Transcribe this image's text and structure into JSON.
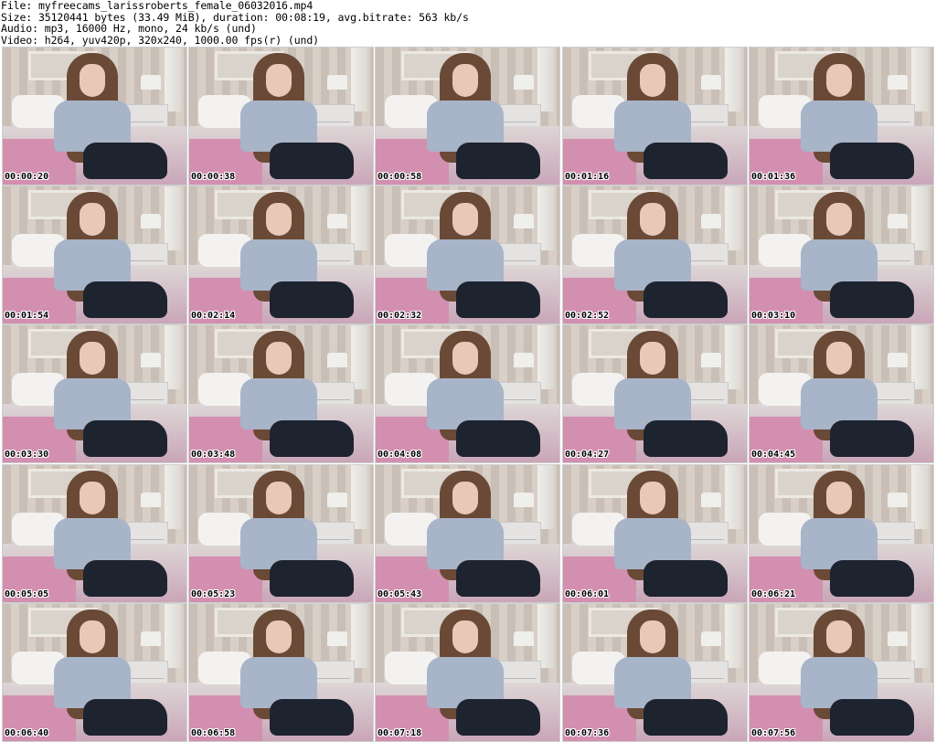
{
  "header": {
    "file_line": "File: myfreecams_larissroberts_female_06032016.mp4",
    "size_line": "Size: 35120441 bytes (33.49 MiB), duration: 00:08:19, avg.bitrate: 563 kb/s",
    "audio_line": "Audio: mp3, 16000 Hz, mono, 24 kb/s (und)",
    "video_line": "Video: h264, yuv420p, 320x240, 1000.00 fps(r) (und)"
  },
  "thumbnails": [
    {
      "time": "00:00:20"
    },
    {
      "time": "00:00:38"
    },
    {
      "time": "00:00:58"
    },
    {
      "time": "00:01:16"
    },
    {
      "time": "00:01:36"
    },
    {
      "time": "00:01:54"
    },
    {
      "time": "00:02:14"
    },
    {
      "time": "00:02:32"
    },
    {
      "time": "00:02:52"
    },
    {
      "time": "00:03:10"
    },
    {
      "time": "00:03:30"
    },
    {
      "time": "00:03:48"
    },
    {
      "time": "00:04:08"
    },
    {
      "time": "00:04:27"
    },
    {
      "time": "00:04:45"
    },
    {
      "time": "00:05:05"
    },
    {
      "time": "00:05:23"
    },
    {
      "time": "00:05:43"
    },
    {
      "time": "00:06:01"
    },
    {
      "time": "00:06:21"
    },
    {
      "time": "00:06:40"
    },
    {
      "time": "00:06:58"
    },
    {
      "time": "00:07:18"
    },
    {
      "time": "00:07:36"
    },
    {
      "time": "00:07:56"
    }
  ]
}
